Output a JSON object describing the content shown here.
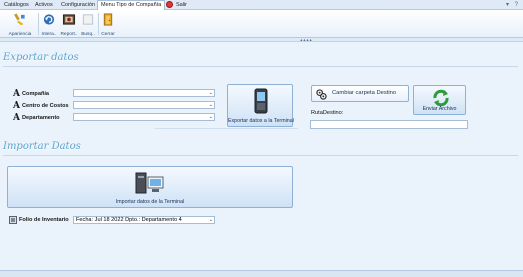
{
  "menu": {
    "tabs": [
      {
        "label": "Catálogos"
      },
      {
        "label": "Activos"
      },
      {
        "label": "Configuración"
      },
      {
        "label": "Menu Tipo de Compañía"
      },
      {
        "label": "Salir"
      }
    ]
  },
  "ribbon": {
    "buttons": [
      {
        "label": "Apariencia",
        "icon": "brush-icon"
      },
      {
        "label": "Intera..",
        "icon": "refresh-icon"
      },
      {
        "label": "Report..",
        "icon": "report-icon"
      },
      {
        "label": "Busq..",
        "icon": "search-icon"
      },
      {
        "label": "Cerrar",
        "icon": "door-icon"
      }
    ]
  },
  "export_section": {
    "title": "Exportar datos",
    "fields": [
      {
        "label": "Compañía",
        "value": ""
      },
      {
        "label": "Centro de Costos",
        "value": ""
      },
      {
        "label": "Departamento",
        "value": ""
      }
    ],
    "export_button": "Exportar datos a la Terminal",
    "change_folder_button": "Cambiar carpeta Destino",
    "send_file_button": "Enviar Archivo",
    "route_label": "RutaDestino:",
    "route_value": ""
  },
  "import_section": {
    "title": "Importar Datos",
    "import_button": "Importar datos de la Terminal",
    "folio_label": "Folio de Inventario",
    "folio_value": "Fecha:  Jul 18 2022   Dpto.:   Departamento 4"
  },
  "colors": {
    "section_title": "#5da6cf",
    "background": "#eaf2fb",
    "button_border": "#8fb1d6"
  }
}
